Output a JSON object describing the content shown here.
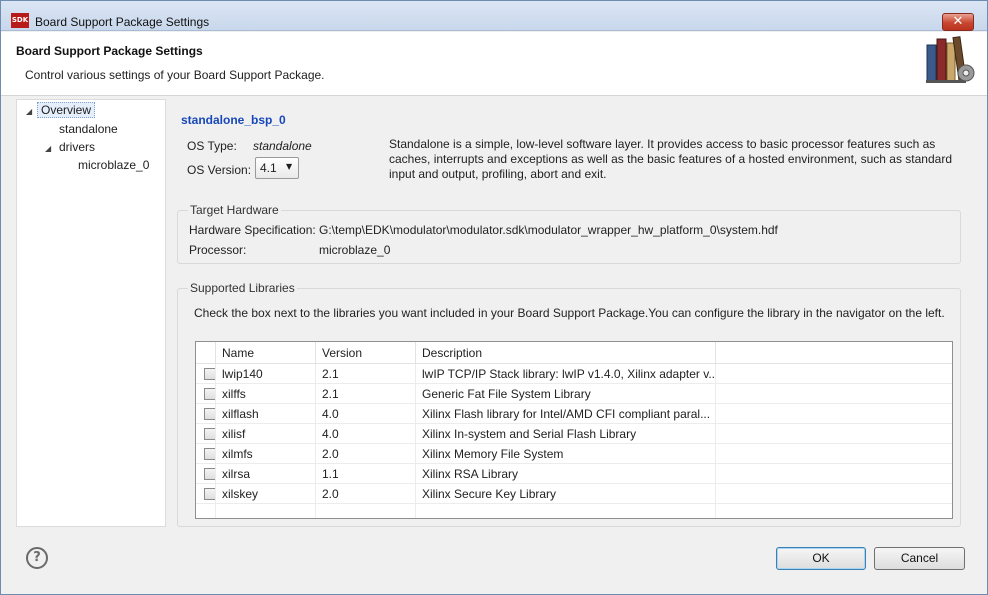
{
  "window": {
    "title": "Board Support Package Settings",
    "logo_text": "SDK",
    "close_glyph": "✕"
  },
  "header": {
    "title": "Board Support Package Settings",
    "description": "Control various settings of your Board Support Package.",
    "icon": "books-gear-icon"
  },
  "navigator": {
    "items": [
      {
        "label": "Overview",
        "expanded": true,
        "selected": true
      },
      {
        "label": "standalone"
      },
      {
        "label": "drivers",
        "expanded": true
      },
      {
        "label": "microblaze_0"
      }
    ]
  },
  "overview": {
    "bsp_name": "standalone_bsp_0",
    "os_type_label": "OS Type:",
    "os_type_value": "standalone",
    "os_version_label": "OS Version:",
    "os_version_value": "4.1",
    "os_description": "Standalone is a simple, low-level software layer. It provides access to basic processor features such as caches, interrupts and exceptions as well as the basic features of a hosted environment, such as standard input and output, profiling, abort and exit."
  },
  "target_hardware": {
    "title": "Target Hardware",
    "spec_label": "Hardware Specification:",
    "spec_value": "G:\\temp\\EDK\\modulator\\modulator.sdk\\modulator_wrapper_hw_platform_0\\system.hdf",
    "processor_label": "Processor:",
    "processor_value": "microblaze_0"
  },
  "libraries": {
    "title": "Supported Libraries",
    "instructions": "Check the box next to the libraries you want included in your Board Support Package.You can configure the library in the navigator on the left.",
    "columns": [
      "Name",
      "Version",
      "Description"
    ],
    "rows": [
      {
        "name": "lwip140",
        "version": "2.1",
        "description": "lwIP TCP/IP Stack library: lwIP v1.4.0, Xilinx adapter v...",
        "checked": false
      },
      {
        "name": "xilffs",
        "version": "2.1",
        "description": "Generic Fat File System Library",
        "checked": false
      },
      {
        "name": "xilflash",
        "version": "4.0",
        "description": "Xilinx Flash library for Intel/AMD CFI compliant paral...",
        "checked": false
      },
      {
        "name": "xilisf",
        "version": "4.0",
        "description": "Xilinx In-system and Serial Flash Library",
        "checked": false
      },
      {
        "name": "xilmfs",
        "version": "2.0",
        "description": "Xilinx Memory File System",
        "checked": false
      },
      {
        "name": "xilrsa",
        "version": "1.1",
        "description": "Xilinx RSA Library",
        "checked": false
      },
      {
        "name": "xilskey",
        "version": "2.0",
        "description": "Xilinx Secure Key Library",
        "checked": false
      }
    ]
  },
  "footer": {
    "help_glyph": "?",
    "ok_label": "OK",
    "cancel_label": "Cancel"
  },
  "colors": {
    "link": "#1747b8",
    "close_button": "#c9462f",
    "selection": "#e5eefb"
  }
}
